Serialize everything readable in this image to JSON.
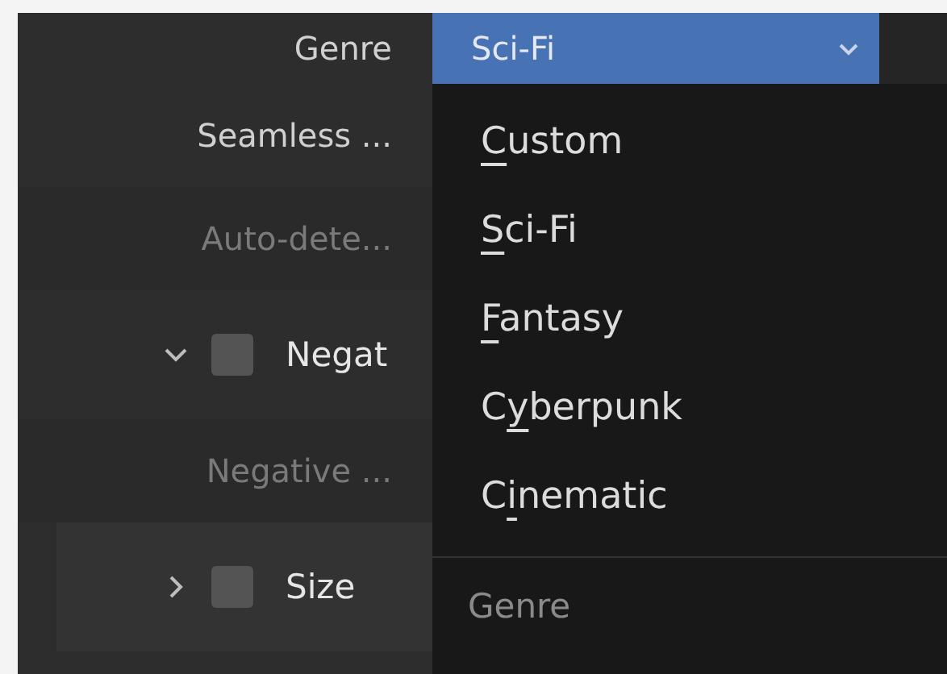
{
  "genre_field": {
    "label": "Genre",
    "value": "Sci-Fi"
  },
  "properties": [
    {
      "kind": "label",
      "text": "Seamless ...",
      "disabled": false
    },
    {
      "kind": "label",
      "text": "Auto-dete...",
      "disabled": true
    },
    {
      "kind": "panel",
      "text": "Negat",
      "expanded": true,
      "checked": false
    },
    {
      "kind": "label",
      "text": "Negative ...",
      "disabled": true
    },
    {
      "kind": "panel",
      "text": "Size",
      "expanded": false,
      "checked": false
    }
  ],
  "menu": {
    "items": [
      {
        "accel": "C",
        "after": "ustom"
      },
      {
        "accel": "S",
        "after": "ci-Fi"
      },
      {
        "accel": "F",
        "after": "antasy"
      },
      {
        "before": "C",
        "accel": "y",
        "after": "berpunk"
      },
      {
        "before": "C",
        "accel": "i",
        "after": "nematic"
      }
    ],
    "title": "Genre"
  }
}
